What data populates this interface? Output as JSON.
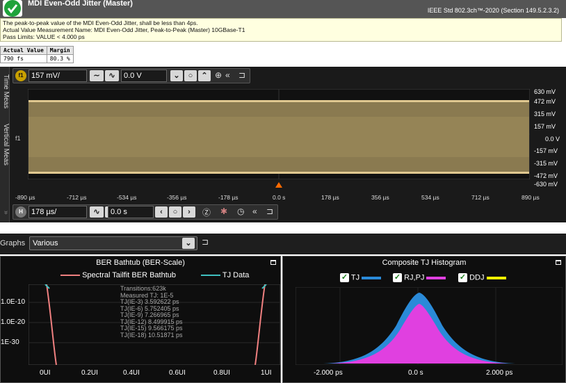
{
  "header": {
    "title": "MDI Even-Odd Jitter (Master)",
    "standard": "IEEE Std 802.3ch™-2020 (Section 149.5.2.3.2)",
    "status": "pass"
  },
  "description": {
    "line1": "The peak-to-peak value of the MDI Even-Odd Jitter, shall be less than 4ps.",
    "line2": "Actual Value Measurement Name: MDI Even-Odd Jitter, Peak-to-Peak (Master) 10GBase-T1",
    "line3": "Pass Limits: VALUE < 4.000 ps"
  },
  "results": {
    "headers": [
      "Actual Value",
      "Margin"
    ],
    "values": [
      "790 fs",
      "80.3 %"
    ]
  },
  "scope": {
    "side_tabs": [
      "Time Meas",
      "Vertical Meas"
    ],
    "channel_badge": "f1",
    "vscale": "157 mV/",
    "voffset": "0.0 V",
    "time_badge": "H",
    "hscale": "178 µs/",
    "hoffset": "0.0 s",
    "y_labels": [
      "630 mV",
      "472 mV",
      "315 mV",
      "157 mV",
      "0.0 V",
      "-157 mV",
      "-315 mV",
      "-472 mV",
      "-630 mV"
    ],
    "x_labels": [
      "-890 µs",
      "-712 µs",
      "-534 µs",
      "-356 µs",
      "-178 µs",
      "0.0 s",
      "178 µs",
      "356 µs",
      "534 µs",
      "712 µs",
      "890 µs"
    ],
    "trace_color": "#c9b27a",
    "ground_marker": "f1"
  },
  "graphs": {
    "label": "Graphs",
    "selected": "Various"
  },
  "bathtub": {
    "title": "BER Bathtub (BER-Scale)",
    "legend": [
      {
        "name": "Spectral Tailfit BER Bathtub",
        "color": "#f08080"
      },
      {
        "name": "TJ Data",
        "color": "#40c0c0"
      }
    ],
    "stats": [
      "Transitions:623k",
      "Measured TJ: 1E-5",
      "TJ(IE-3) 3.592622 ps",
      "TJ(IE-6) 5.752405 ps",
      "TJ(IE-9) 7.266965 ps",
      "TJ(IE-12) 8.499915 ps",
      "TJ(IE-15) 9.566175 ps",
      "TJ(IE-18) 10.51871 ps"
    ],
    "y_labels": [
      "1.0E-10",
      "1.0E-20",
      "1E-30"
    ],
    "x_labels": [
      "0UI",
      "0.2UI",
      "0.4UI",
      "0.6UI",
      "0.8UI",
      "1UI"
    ]
  },
  "histogram": {
    "title": "Composite TJ Histogram",
    "legend": [
      {
        "name": "TJ",
        "color": "#2a8ad8"
      },
      {
        "name": "RJ,PJ",
        "color": "#e040e0"
      },
      {
        "name": "DDJ",
        "color": "#f0f000"
      }
    ],
    "x_labels": [
      "-2.000 ps",
      "0.0 s",
      "2.000 ps"
    ]
  }
}
